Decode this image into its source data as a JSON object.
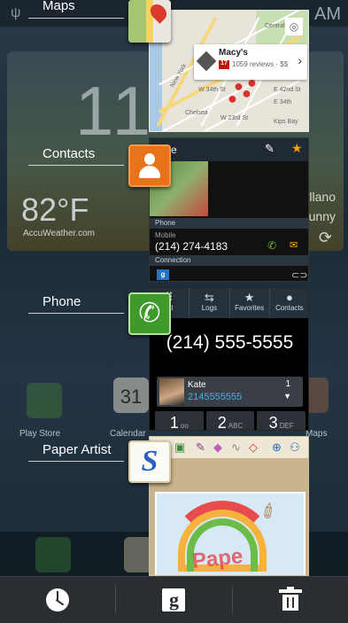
{
  "status_bar": {
    "time": "AM"
  },
  "background": {
    "clock_digits": "11",
    "temperature": "82°F",
    "weather_brand": "AccuWeather.com",
    "weather_city_partial": "llano",
    "weather_cond_partial": "unny",
    "home_apps": [
      "Play Store",
      "Calendar",
      "Maps"
    ],
    "calendar_day": "31"
  },
  "recents": [
    {
      "label": "Maps",
      "icon": "google-maps-icon",
      "map_card": {
        "title": "Macy's",
        "rating_badge": "17",
        "reviews": "1059 reviews · $$",
        "chevron": "›"
      },
      "map_labels": [
        "Central P",
        "New York",
        "W 34th St",
        "Chelsea",
        "W 23rd St",
        "Kips Bay",
        "E 42nd St",
        "E 34th"
      ]
    },
    {
      "label": "Contacts",
      "icon": "contacts-icon",
      "contact_name": "nnie",
      "section_phone": "Phone",
      "phone_type": "Mobile",
      "phone_number": "(214) 274-4183",
      "section_connection": "Connection",
      "connection_badge": "g"
    },
    {
      "label": "Phone",
      "icon": "phone-icon",
      "tabs": [
        "ad",
        "Logs",
        "Favorites",
        "Contacts"
      ],
      "dialed_number": "(214) 555-5555",
      "suggestion": {
        "name": "Kate",
        "number": "2145555555",
        "count": "1"
      },
      "keys": [
        {
          "digit": "1",
          "letters": "oo"
        },
        {
          "digit": "2",
          "letters": "ABC"
        },
        {
          "digit": "3",
          "letters": "DEF"
        }
      ]
    },
    {
      "label": "Paper Artist",
      "icon": "paper-artist-icon",
      "canvas_text": "Pape"
    }
  ],
  "bottom_bar": {
    "task_manager_icon": "task-manager-icon",
    "google_label": "g",
    "remove_all_icon": "trash-icon"
  }
}
